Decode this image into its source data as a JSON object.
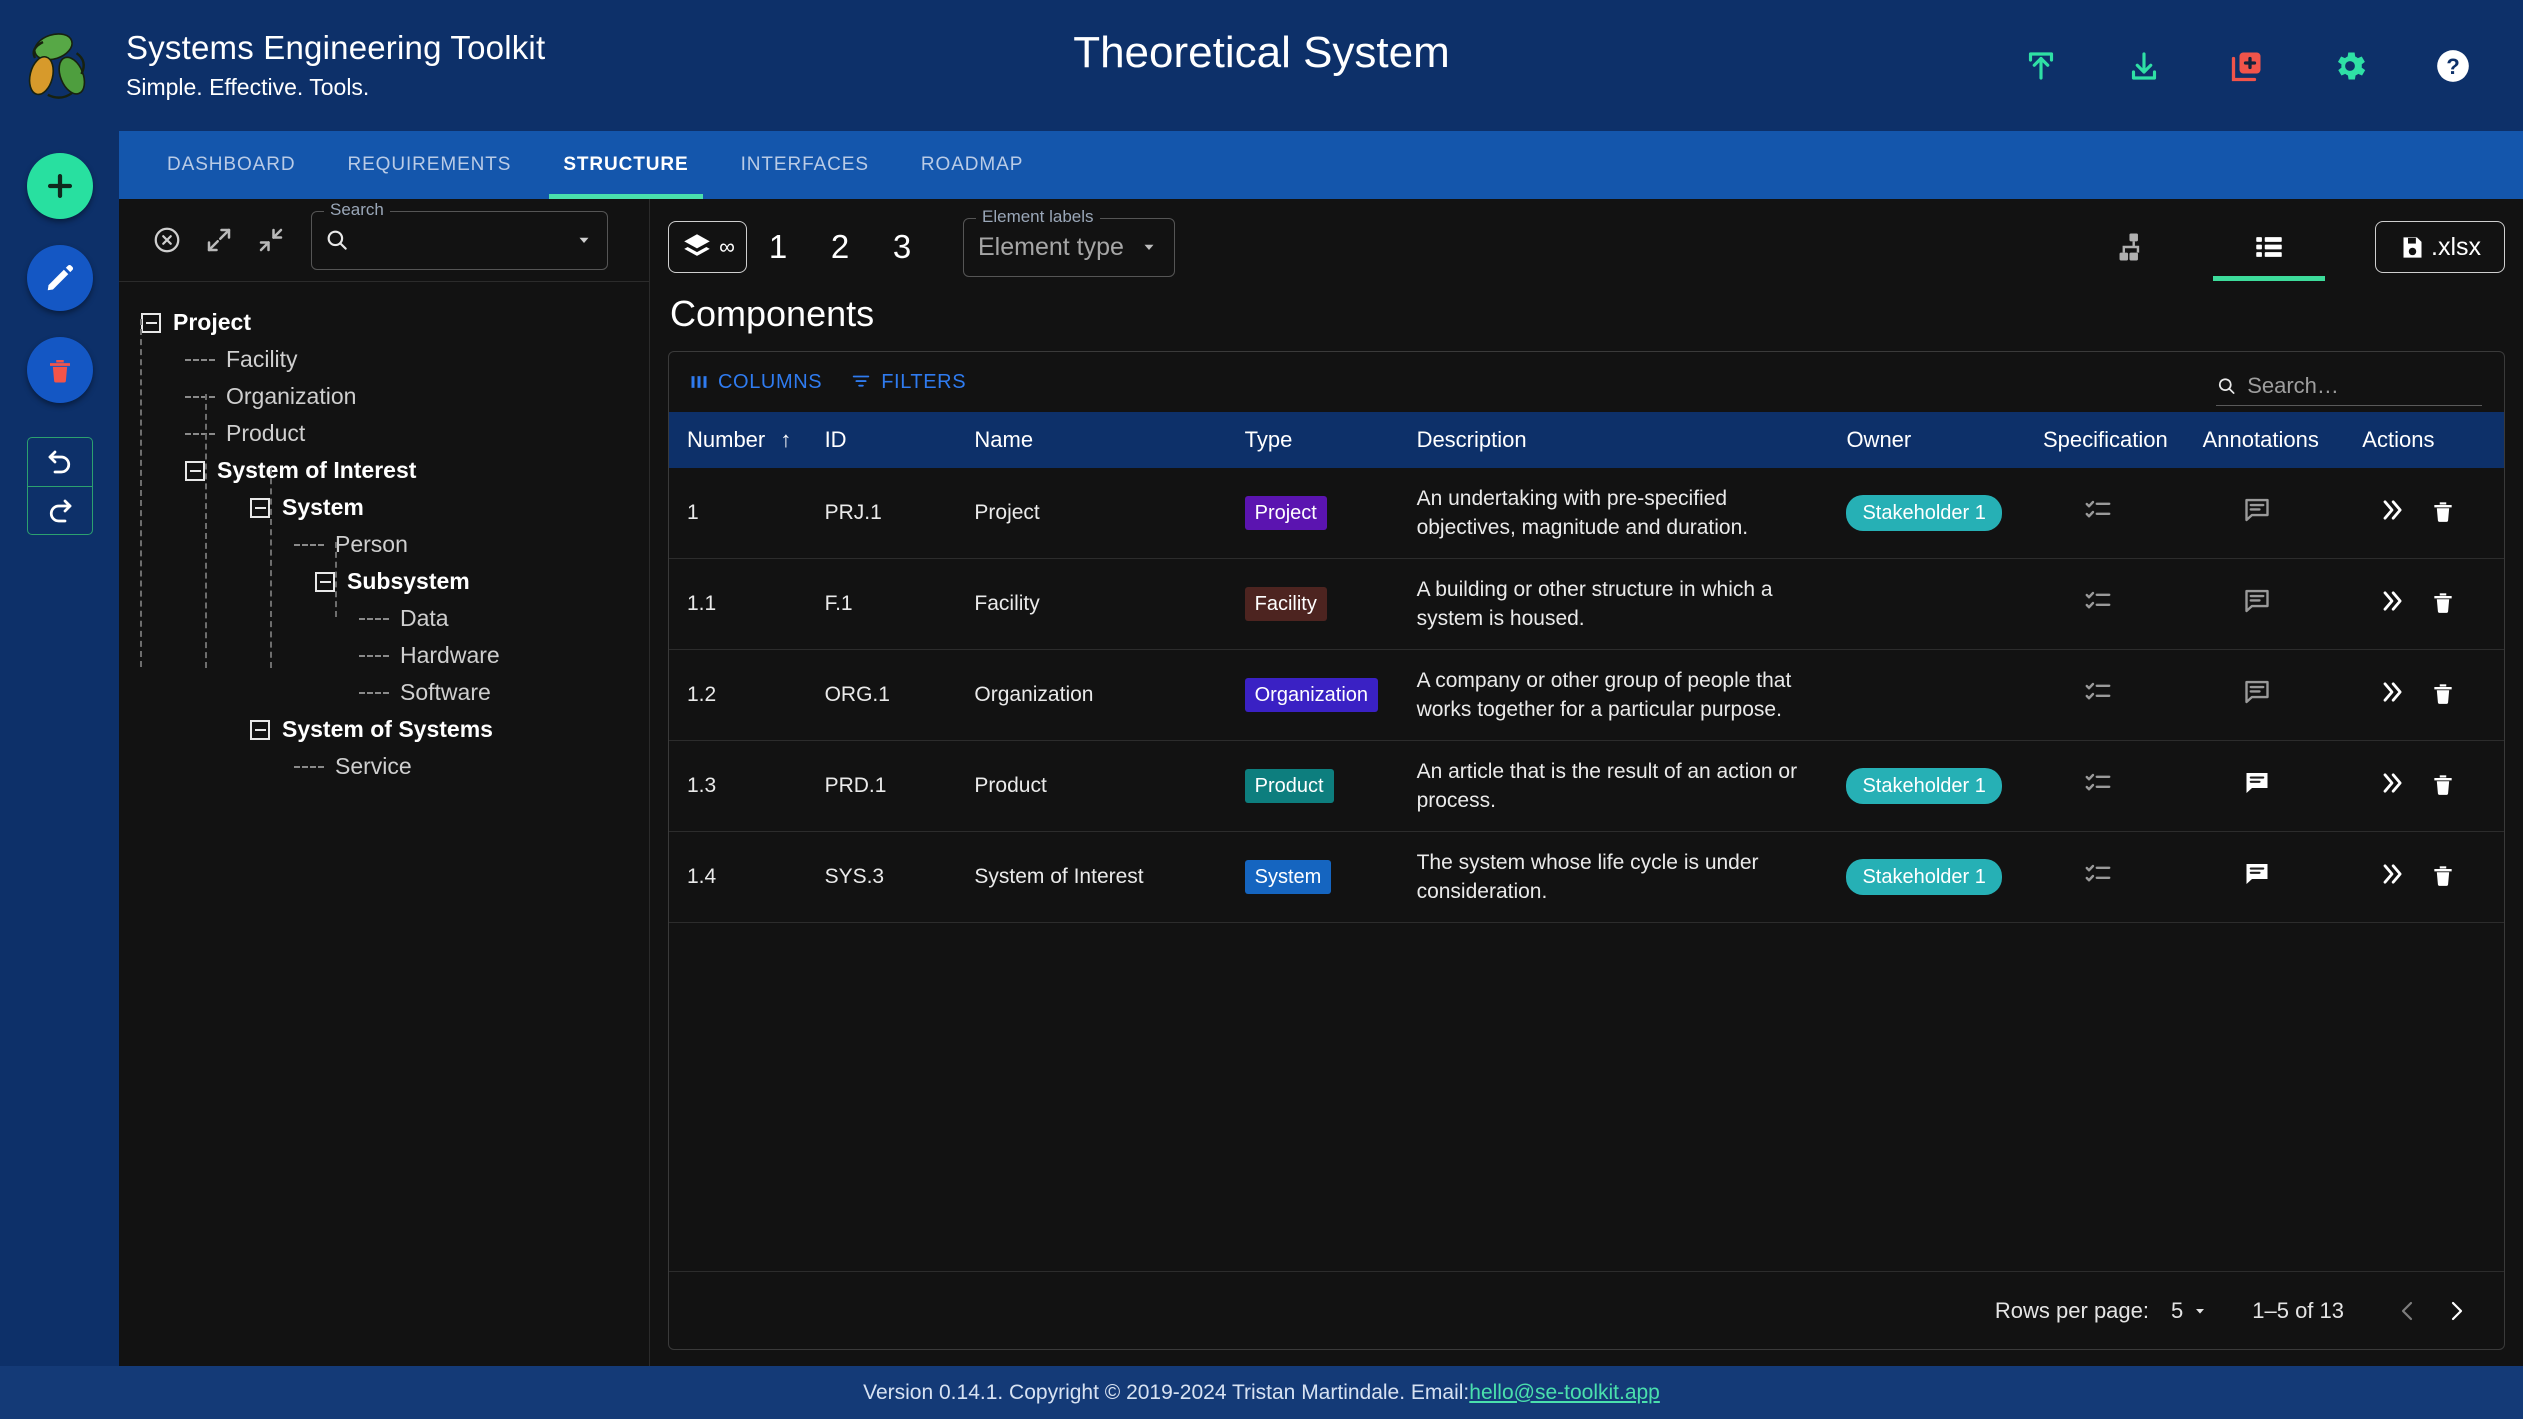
{
  "header": {
    "brand_title": "Systems Engineering Toolkit",
    "brand_subtitle": "Simple. Effective. Tools.",
    "document_title": "Theoretical System",
    "icons": [
      {
        "name": "upload-icon",
        "label": "Upload"
      },
      {
        "name": "download-icon",
        "label": "Download"
      },
      {
        "name": "new-document-icon",
        "label": "New"
      },
      {
        "name": "settings-gear-icon",
        "label": "Settings"
      },
      {
        "name": "help-icon",
        "label": "Help"
      }
    ],
    "accent_green": "#28e0a0",
    "brand_blue": "#0d3069",
    "alert_red": "#f2544a"
  },
  "rail": {
    "add_label": "Add",
    "edit_label": "Edit",
    "delete_label": "Delete",
    "undo_label": "Undo",
    "redo_label": "Redo"
  },
  "tabs": [
    {
      "label": "DASHBOARD",
      "active": false
    },
    {
      "label": "REQUIREMENTS",
      "active": false
    },
    {
      "label": "STRUCTURE",
      "active": true
    },
    {
      "label": "INTERFACES",
      "active": false
    },
    {
      "label": "ROADMAP",
      "active": false
    }
  ],
  "tree_toolbar": {
    "clear_label": "Clear selection",
    "expand_label": "Expand all",
    "collapse_label": "Collapse all",
    "search_legend": "Search",
    "search_value": "",
    "search_placeholder": ""
  },
  "tree": [
    {
      "label": "Project",
      "depth": 0,
      "expandable": true,
      "bold": true
    },
    {
      "label": "Facility",
      "depth": 1,
      "expandable": false,
      "bold": false
    },
    {
      "label": "Organization",
      "depth": 1,
      "expandable": false,
      "bold": false
    },
    {
      "label": "Product",
      "depth": 1,
      "expandable": false,
      "bold": false
    },
    {
      "label": "System of Interest",
      "depth": 1,
      "expandable": true,
      "bold": true
    },
    {
      "label": "System",
      "depth": 2,
      "expandable": true,
      "bold": true
    },
    {
      "label": "Person",
      "depth": 3,
      "expandable": false,
      "bold": false
    },
    {
      "label": "Subsystem",
      "depth": 3,
      "expandable": true,
      "bold": true
    },
    {
      "label": "Data",
      "depth": 4,
      "expandable": false,
      "bold": false
    },
    {
      "label": "Hardware",
      "depth": 4,
      "expandable": false,
      "bold": false
    },
    {
      "label": "Software",
      "depth": 4,
      "expandable": false,
      "bold": false
    },
    {
      "label": "System of Systems",
      "depth": 2,
      "expandable": true,
      "bold": true
    },
    {
      "label": "Service",
      "depth": 3,
      "expandable": false,
      "bold": false
    }
  ],
  "view_toolbar": {
    "layers_label": "∞",
    "depth_buttons": [
      "1",
      "2",
      "3"
    ],
    "element_labels_legend": "Element labels",
    "element_labels_value": "Element type",
    "diagram_view_label": "Diagram view",
    "table_view_label": "Table view",
    "export_label": ".xlsx"
  },
  "main": {
    "panel_title": "Components",
    "grid_toolbar": {
      "columns_label": "COLUMNS",
      "filters_label": "FILTERS",
      "search_value": "",
      "search_placeholder": "Search…"
    },
    "columns": [
      {
        "key": "number",
        "label": "Number",
        "sorted": "asc"
      },
      {
        "key": "id",
        "label": "ID"
      },
      {
        "key": "name",
        "label": "Name"
      },
      {
        "key": "type",
        "label": "Type"
      },
      {
        "key": "description",
        "label": "Description"
      },
      {
        "key": "owner",
        "label": "Owner"
      },
      {
        "key": "specification",
        "label": "Specification"
      },
      {
        "key": "annotations",
        "label": "Annotations"
      },
      {
        "key": "actions",
        "label": "Actions"
      }
    ],
    "rows": [
      {
        "number": "1",
        "id": "PRJ.1",
        "name": "Project",
        "type": "Project",
        "type_color": "#5b14b0",
        "description": "An undertaking with pre-specified objectives, magnitude and duration.",
        "owner": "Stakeholder 1",
        "specification_icon": "checklist-icon",
        "annotation_icon": "comment-list-icon",
        "annotation_active": false
      },
      {
        "number": "1.1",
        "id": "F.1",
        "name": "Facility",
        "type": "Facility",
        "type_color": "#4d2420",
        "description": "A building or other structure in which a system is housed.",
        "owner": "",
        "specification_icon": "checklist-icon",
        "annotation_icon": "comment-list-icon",
        "annotation_active": false
      },
      {
        "number": "1.2",
        "id": "ORG.1",
        "name": "Organization",
        "type": "Organization",
        "type_color": "#3a21c4",
        "description": "A company or other group of people that works together for a particular purpose.",
        "owner": "",
        "specification_icon": "checklist-icon",
        "annotation_icon": "comment-list-icon",
        "annotation_active": false
      },
      {
        "number": "1.3",
        "id": "PRD.1",
        "name": "Product",
        "type": "Product",
        "type_color": "#0d7e7e",
        "description": "An article that is the result of an action or process.",
        "owner": "Stakeholder 1",
        "specification_icon": "checklist-icon",
        "annotation_icon": "comment-list-icon",
        "annotation_active": true
      },
      {
        "number": "1.4",
        "id": "SYS.3",
        "name": "System of Interest",
        "type": "System",
        "type_color": "#1565c0",
        "description": "The system whose life cycle is under consideration.",
        "owner": "Stakeholder 1",
        "specification_icon": "checklist-icon",
        "annotation_icon": "comment-list-icon",
        "annotation_active": true
      }
    ],
    "pagination": {
      "rows_per_page_label": "Rows per page:",
      "rows_per_page_value": "5",
      "range_label": "1–5 of 13",
      "prev_label": "Previous page",
      "next_label": "Next page"
    }
  },
  "footer": {
    "text": "Version 0.14.1. Copyright © 2019-2024 Tristan Martindale. Email: ",
    "email": "hello@se-toolkit.app"
  }
}
